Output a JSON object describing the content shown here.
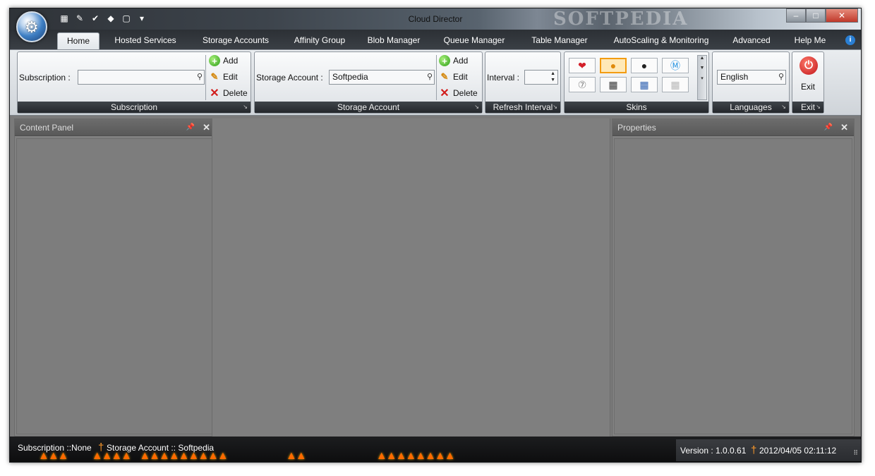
{
  "window": {
    "title": "Cloud Director",
    "watermark": "SOFTPEDIA",
    "controls": {
      "minimize": "–",
      "maximize": "□",
      "close": "✕"
    }
  },
  "quick_access": [
    {
      "icon": "open-icon",
      "glyph": "▦"
    },
    {
      "icon": "new-icon",
      "glyph": "✎"
    },
    {
      "icon": "check-icon",
      "glyph": "✔"
    },
    {
      "icon": "tag-icon",
      "glyph": "◆"
    },
    {
      "icon": "page-icon",
      "glyph": "▢"
    },
    {
      "icon": "dropdown-icon",
      "glyph": "▾"
    }
  ],
  "tabs": [
    "Home",
    "Hosted Services",
    "Storage Accounts",
    "Affinity Group",
    "Blob Manager",
    "Queue Manager",
    "Table Manager",
    "AutoScaling & Monitoring",
    "Advanced",
    "Help Me"
  ],
  "ribbon": {
    "subscription": {
      "label": "Subscription :",
      "value": "",
      "add": "Add",
      "edit": "Edit",
      "delete": "Delete",
      "group_label": "Subscription"
    },
    "storage": {
      "label": "Storage Account :",
      "value": "Softpedia",
      "add": "Add",
      "edit": "Edit",
      "delete": "Delete",
      "group_label": "Storage Account"
    },
    "refresh": {
      "label": "Interval :",
      "value": "",
      "group_label": "Refresh Interval"
    },
    "skins": {
      "group_label": "Skins",
      "items": [
        {
          "icon": "heart-skin-icon",
          "glyph": "❤",
          "color": "#d3202a",
          "selected": false
        },
        {
          "icon": "pumpkin-skin-icon",
          "glyph": "●",
          "color": "#e08a0b",
          "selected": true
        },
        {
          "icon": "black-skin-icon",
          "glyph": "●",
          "color": "#222222",
          "selected": false
        },
        {
          "icon": "blue-skin-icon",
          "glyph": "Ⓜ",
          "color": "#1d8fe0",
          "selected": false
        },
        {
          "icon": "grey-skin-icon",
          "glyph": "⑦",
          "color": "#8a8a8a",
          "selected": false
        },
        {
          "icon": "dark-tiles-skin-icon",
          "glyph": "▦",
          "color": "#333333",
          "selected": false
        },
        {
          "icon": "blue-tiles-skin-icon",
          "glyph": "▦",
          "color": "#2b5fb0",
          "selected": false
        },
        {
          "icon": "light-tiles-skin-icon",
          "glyph": "▦",
          "color": "#b8b8b8",
          "selected": false
        }
      ]
    },
    "languages": {
      "value": "English",
      "group_label": "Languages"
    },
    "exit": {
      "label": "Exit",
      "group_label": "Exit"
    }
  },
  "panels": {
    "content": {
      "title": "Content Panel"
    },
    "properties": {
      "title": "Properties"
    }
  },
  "status": {
    "subscription": "Subscription ::None",
    "storage": "Storage Account :: Softpedia",
    "version": "Version : 1.0.0.61",
    "datetime": "2012/04/05 02:11:12"
  },
  "colors": {
    "accent": "#f39c12",
    "flame": "#ff6a00",
    "workspace": "#7f7f7f"
  }
}
